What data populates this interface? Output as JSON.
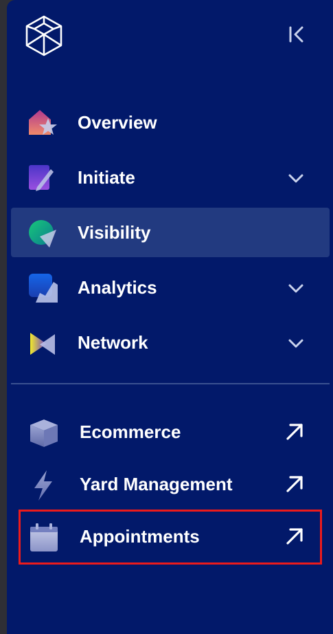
{
  "logo": {
    "icon": "cube-logo-icon"
  },
  "collapse": {
    "icon": "collapse-sidebar-icon"
  },
  "nav": [
    {
      "label": "Overview",
      "icon": "overview-icon",
      "has_submenu": false,
      "active": false
    },
    {
      "label": "Initiate",
      "icon": "initiate-icon",
      "has_submenu": true,
      "active": false
    },
    {
      "label": "Visibility",
      "icon": "visibility-icon",
      "has_submenu": false,
      "active": true
    },
    {
      "label": "Analytics",
      "icon": "analytics-icon",
      "has_submenu": true,
      "active": false
    },
    {
      "label": "Network",
      "icon": "network-icon",
      "has_submenu": true,
      "active": false
    }
  ],
  "external": [
    {
      "label": "Ecommerce",
      "icon": "ecommerce-box-icon"
    },
    {
      "label": "Yard Management",
      "icon": "lightning-icon"
    },
    {
      "label": "Appointments",
      "icon": "calendar-icon"
    }
  ],
  "colors": {
    "sidebar_bg": "#02196a",
    "active_bg": "#223a80",
    "text": "#ffffff",
    "highlight": "#ec1b1b"
  }
}
